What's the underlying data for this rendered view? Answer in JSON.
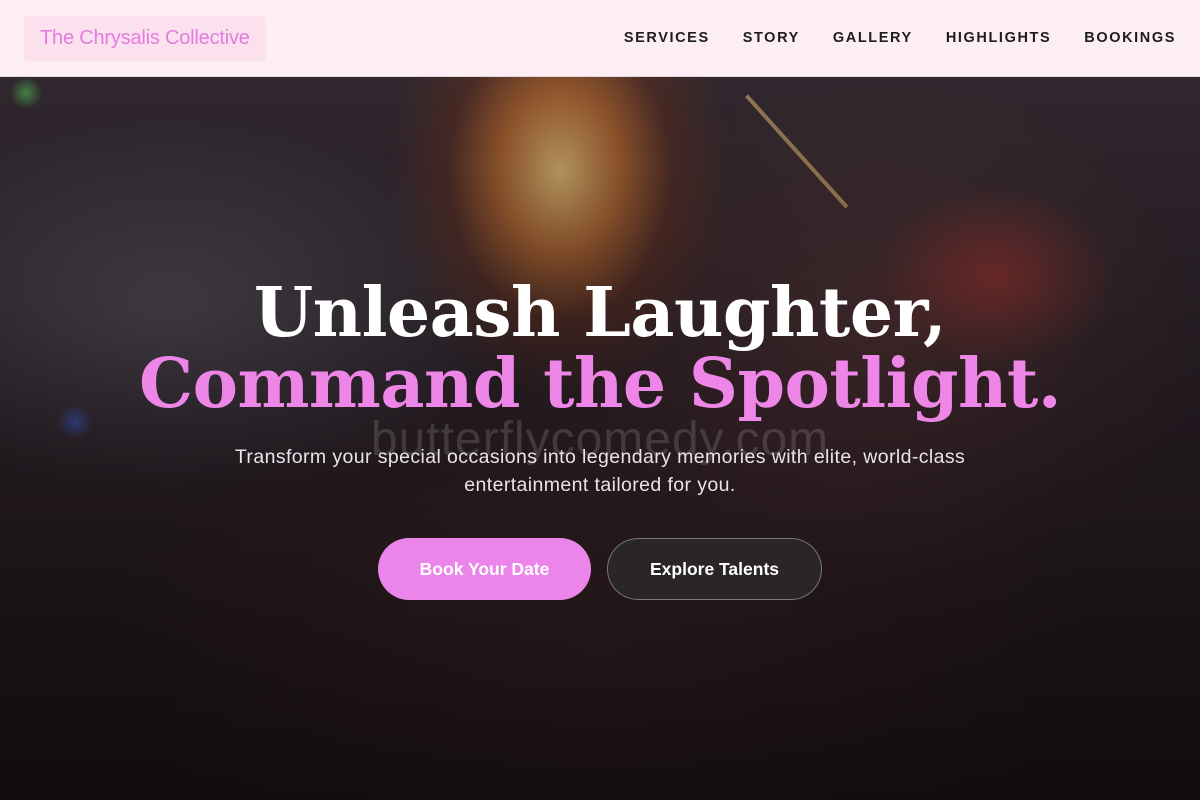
{
  "header": {
    "brand": "The Chrysalis Collective",
    "nav": [
      {
        "label": "SERVICES"
      },
      {
        "label": "STORY"
      },
      {
        "label": "GALLERY"
      },
      {
        "label": "HIGHLIGHTS"
      },
      {
        "label": "BOOKINGS"
      }
    ]
  },
  "hero": {
    "headline_line1": "Unleash Laughter,",
    "headline_line2": "Command the Spotlight.",
    "watermark": "butterflycomedy.com",
    "subtitle": "Transform your special occasions into legendary memories with elite, world-class entertainment tailored for you.",
    "primary_button": "Book Your Date",
    "secondary_button": "Explore Talents"
  },
  "colors": {
    "accent": "#ec85ea",
    "nav_background": "#fdeef3",
    "brand_text": "#e47be0",
    "brand_background": "#fbe1ee"
  }
}
